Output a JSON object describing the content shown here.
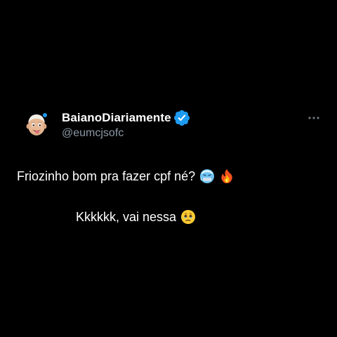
{
  "tweet": {
    "author": {
      "display_name": "BaianoDiariamente",
      "handle": "@eumcjsofc",
      "verified": true,
      "avatar_icon": "memoji-avatar-icon"
    },
    "more_icon": "more-options-icon",
    "lines": [
      {
        "text": "Friozinho bom pra fazer cpf né?",
        "emojis": [
          "cold-face-icon",
          "fire-icon"
        ]
      },
      {
        "text": "Kkkkkk, vai nessa",
        "emojis": [
          "face-holding-back-tears-icon"
        ]
      }
    ]
  },
  "colors": {
    "background": "#000000",
    "text": "#ffffff",
    "secondary_text": "#8b98a5",
    "verified_badge": "#1d9bf0"
  }
}
